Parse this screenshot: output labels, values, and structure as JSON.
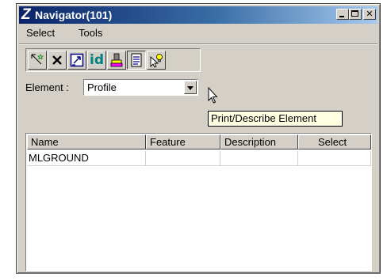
{
  "window": {
    "title": "Navigator(101)",
    "app_icon": "Z",
    "controls": [
      "minimize",
      "maximize",
      "close"
    ]
  },
  "menu": {
    "items": [
      "Select",
      "Tools"
    ]
  },
  "toolbar": {
    "buttons": [
      {
        "name": "select-element-tool",
        "icon": "wand-icon"
      },
      {
        "name": "delete-tool",
        "icon": "x-icon"
      },
      {
        "name": "fit-view-tool",
        "icon": "fit-window-icon"
      },
      {
        "name": "identify-tool",
        "icon": "id-icon",
        "label": "id"
      },
      {
        "name": "highlight-tool",
        "icon": "paint-icon"
      },
      {
        "name": "print-describe-tool",
        "icon": "document-icon"
      },
      {
        "name": "locate-tool",
        "icon": "pointer-bulb-icon"
      }
    ]
  },
  "element_filter": {
    "label": "Element :",
    "value": "Profile"
  },
  "tooltip": {
    "text": "Print/Describe Element"
  },
  "list": {
    "columns": [
      "Name",
      "Feature",
      "Description",
      "Select"
    ],
    "rows": [
      {
        "name": "MLGROUND",
        "feature": "",
        "description": "",
        "select": ""
      }
    ]
  },
  "colors": {
    "titlebar_start": "#0a246a",
    "titlebar_end": "#a6caf0",
    "face": "#d4d0c8",
    "tooltip_bg": "#ffffe1"
  }
}
